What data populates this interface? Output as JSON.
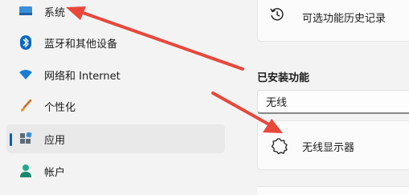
{
  "sidebar": {
    "items": [
      {
        "label": "系统",
        "icon": "monitor-icon",
        "active": false
      },
      {
        "label": "蓝牙和其他设备",
        "icon": "bluetooth-icon",
        "active": false
      },
      {
        "label": "网络和 Internet",
        "icon": "wifi-icon",
        "active": false
      },
      {
        "label": "个性化",
        "icon": "brush-icon",
        "active": false
      },
      {
        "label": "应用",
        "icon": "apps-icon",
        "active": true
      },
      {
        "label": "帐户",
        "icon": "person-icon",
        "active": false
      }
    ]
  },
  "main": {
    "history_link": {
      "label": "可选功能历史记录",
      "icon": "history-icon"
    },
    "installed_title": "已安装功能",
    "search": {
      "value": "无线"
    },
    "feature": {
      "label": "无线显示器",
      "icon": "gear-icon"
    }
  },
  "colors": {
    "accent": "#005fb8",
    "annotation_arrow": "#e8473a"
  }
}
